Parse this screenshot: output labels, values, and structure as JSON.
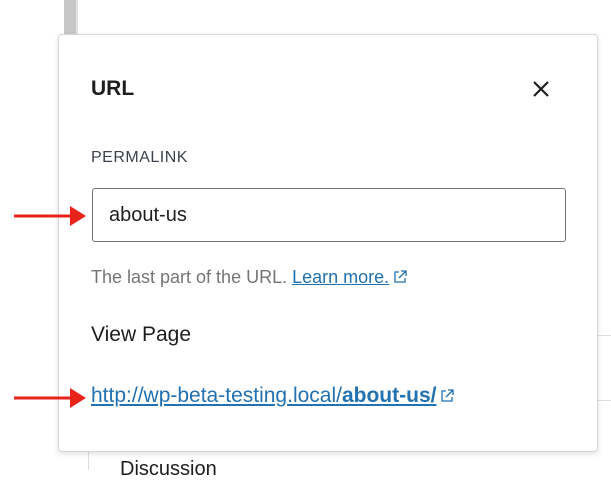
{
  "popover": {
    "title": "URL",
    "close_label": "Close",
    "permalink_label": "PERMALINK",
    "permalink_value": "about-us",
    "help_text": "The last part of the URL.",
    "learn_more": "Learn more.",
    "view_page_label": "View Page",
    "url_prefix": "http://wp-beta-testing.local/",
    "url_slug": "about-us/"
  },
  "background": {
    "section_label": "Discussion"
  },
  "colors": {
    "link": "#2271b1",
    "annotation_arrow": "#e8231a"
  }
}
